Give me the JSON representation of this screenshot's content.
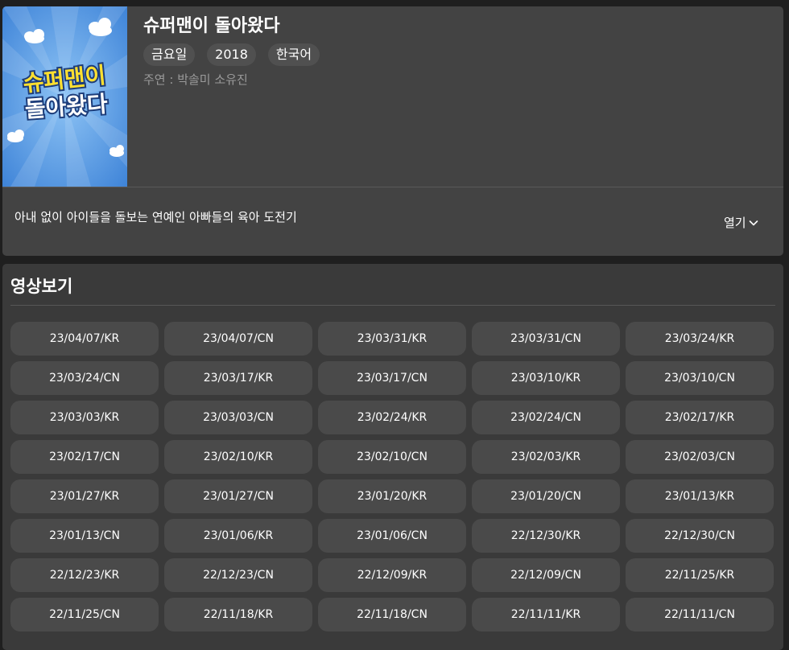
{
  "show": {
    "title": "슈퍼맨이 돌아왔다",
    "tags": [
      "금요일",
      "2018",
      "한국어"
    ],
    "cast": "주연 : 박솔미 소유진",
    "synopsis": "아내 없이 아이들을 돌보는 연예인 아빠들의 육아 도전기",
    "expand_label": "열기",
    "poster_lines": [
      "슈퍼맨이",
      "돌아왔다"
    ]
  },
  "videos": {
    "section_title": "영상보기",
    "episodes": [
      "23/04/07/KR",
      "23/04/07/CN",
      "23/03/31/KR",
      "23/03/31/CN",
      "23/03/24/KR",
      "23/03/24/CN",
      "23/03/17/KR",
      "23/03/17/CN",
      "23/03/10/KR",
      "23/03/10/CN",
      "23/03/03/KR",
      "23/03/03/CN",
      "23/02/24/KR",
      "23/02/24/CN",
      "23/02/17/KR",
      "23/02/17/CN",
      "23/02/10/KR",
      "23/02/10/CN",
      "23/02/03/KR",
      "23/02/03/CN",
      "23/01/27/KR",
      "23/01/27/CN",
      "23/01/20/KR",
      "23/01/20/CN",
      "23/01/13/KR",
      "23/01/13/CN",
      "23/01/06/KR",
      "23/01/06/CN",
      "22/12/30/KR",
      "22/12/30/CN",
      "22/12/23/KR",
      "22/12/23/CN",
      "22/12/09/KR",
      "22/12/09/CN",
      "22/11/25/KR",
      "22/11/25/CN",
      "22/11/18/KR",
      "22/11/18/CN",
      "22/11/11/KR",
      "22/11/11/CN"
    ]
  },
  "colors": {
    "page_bg": "#1f1f1f",
    "card_bg": "#434343",
    "button_bg": "#4a4a4a",
    "muted_text": "#9a9a9a",
    "poster_sky": "#4a8fe0"
  }
}
